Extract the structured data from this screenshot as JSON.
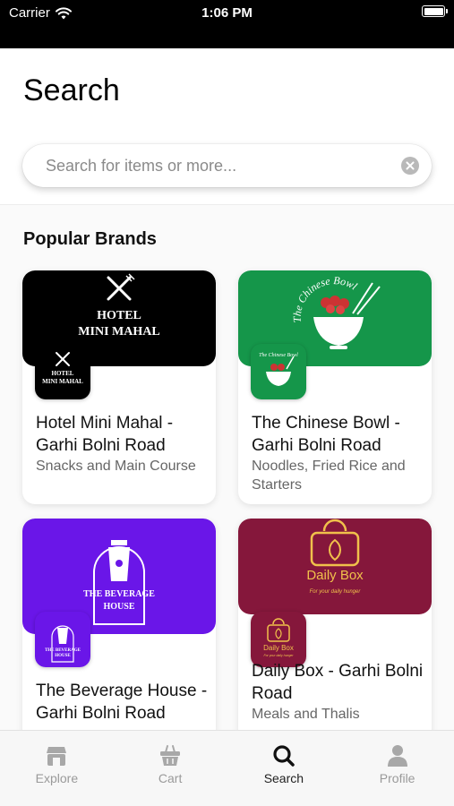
{
  "status_bar": {
    "carrier": "Carrier",
    "time": "1:06 PM"
  },
  "page": {
    "title": "Search"
  },
  "search": {
    "placeholder": "Search for items or more..."
  },
  "section": {
    "title": "Popular Brands"
  },
  "brands": [
    {
      "name": "Hotel Mini Mahal - Garhi Bolni Road",
      "subtitle": "Snacks and Main Course",
      "logo_text": [
        "HOTEL",
        "MINI MAHAL"
      ],
      "banner_color": "#000000"
    },
    {
      "name": "The Chinese Bowl - Garhi Bolni Road",
      "subtitle": "Noodles, Fried Rice and Starters",
      "logo_text": [
        "The Chinese Bowl"
      ],
      "banner_color": "#15964a"
    },
    {
      "name": "The Beverage House - Garhi Bolni Road",
      "subtitle": "",
      "logo_text": [
        "THE BEVERAGE",
        "HOUSE"
      ],
      "banner_color": "#6a16e8"
    },
    {
      "name": "Daily Box - Garhi Bolni Road",
      "subtitle": "Meals and Thalis",
      "logo_text": [
        "Daily Box",
        "For your daily hunger"
      ],
      "banner_color": "#85173b"
    }
  ],
  "tabs": [
    {
      "label": "Explore",
      "icon": "store-icon",
      "active": false
    },
    {
      "label": "Cart",
      "icon": "basket-icon",
      "active": false
    },
    {
      "label": "Search",
      "icon": "search-icon",
      "active": true
    },
    {
      "label": "Profile",
      "icon": "person-icon",
      "active": false
    }
  ],
  "colors": {
    "accent_text": "#222222",
    "inactive_tab": "#9a9a9a"
  }
}
